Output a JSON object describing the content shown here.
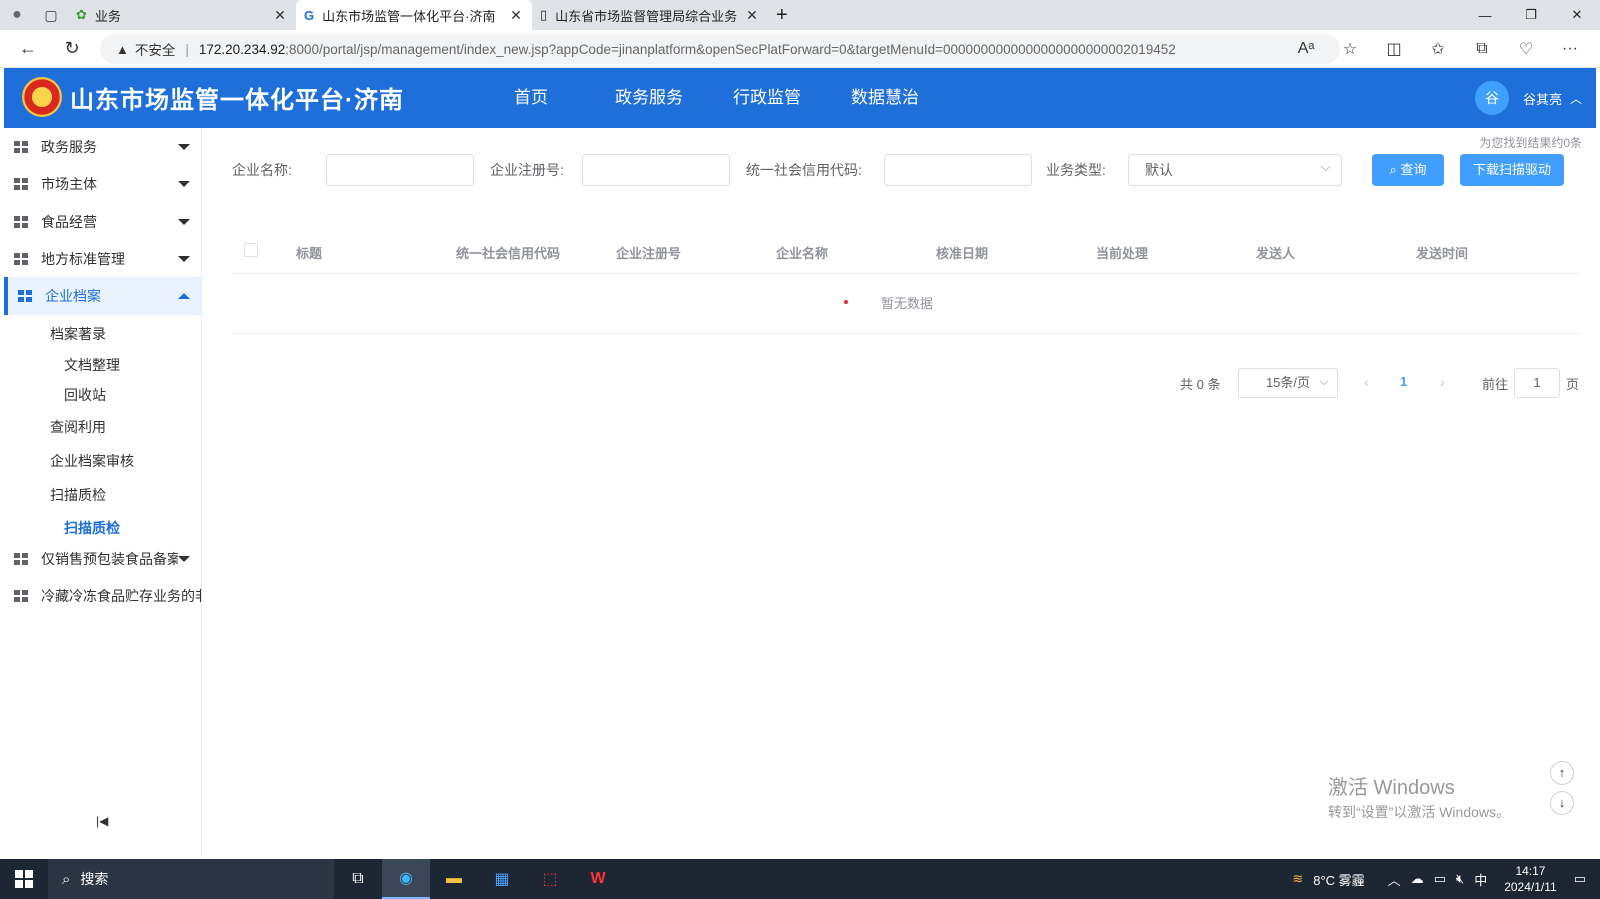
{
  "browser": {
    "tabs": [
      {
        "title": "业务",
        "active": false
      },
      {
        "title": "山东市场监管一体化平台·济南",
        "active": true
      },
      {
        "title": "山东省市场监督管理局综合业务",
        "active": false
      }
    ],
    "new_tab": "+",
    "security_label": "不安全",
    "url_host": "172.20.234.92",
    "url_path": ":8000/portal/jsp/management/index_new.jsp?appCode=jinanplatform&openSecPlatForward=0&targetMenuId=0000000000000000000000002019452"
  },
  "app": {
    "title": "山东市场监管一体化平台·济南",
    "nav": [
      "首页",
      "政务服务",
      "行政监管",
      "数据慧治"
    ],
    "user_avatar": "谷",
    "user_name": "谷其亮"
  },
  "sidebar": {
    "items": [
      {
        "label": "政务服务",
        "expanded": false
      },
      {
        "label": "市场主体",
        "expanded": false
      },
      {
        "label": "食品经营",
        "expanded": false
      },
      {
        "label": "地方标准管理",
        "expanded": false
      },
      {
        "label": "企业档案",
        "expanded": true,
        "active": true
      },
      {
        "label": "仅销售预包装食品备案",
        "expanded": false
      },
      {
        "label": "冷藏冷冻食品贮存业务的非",
        "expanded": false
      }
    ],
    "sub": {
      "archive_catalog": "档案著录",
      "doc_organize": "文档整理",
      "recycle": "回收站",
      "query_use": "查阅利用",
      "archive_review": "企业档案审核",
      "scan_qc": "扫描质检",
      "scan_qc_leaf": "扫描质检"
    }
  },
  "main": {
    "result_hint": "为您找到结果约0条",
    "form": {
      "company_name_label": "企业名称:",
      "reg_no_label": "企业注册号:",
      "credit_code_label": "统一社会信用代码:",
      "biz_type_label": "业务类型:",
      "biz_type_value": "默认",
      "query_button": "查询",
      "download_button": "下载扫描驱动"
    },
    "table": {
      "columns": [
        "标题",
        "统一社会信用代码",
        "企业注册号",
        "企业名称",
        "核准日期",
        "当前处理",
        "发送人",
        "发送时间"
      ],
      "empty_text": "暂无数据"
    },
    "pager": {
      "total": "共 0 条",
      "page_size": "15条/页",
      "current": "1",
      "goto_label": "前往",
      "goto_value": "1",
      "page_suffix": "页"
    }
  },
  "watermark": {
    "line1": "激活 Windows",
    "line2": "转到“设置”以激活 Windows。"
  },
  "taskbar": {
    "search": "搜索",
    "weather": "8°C 雾霾",
    "ime": "中",
    "time": "14:17",
    "date": "2024/1/11"
  }
}
